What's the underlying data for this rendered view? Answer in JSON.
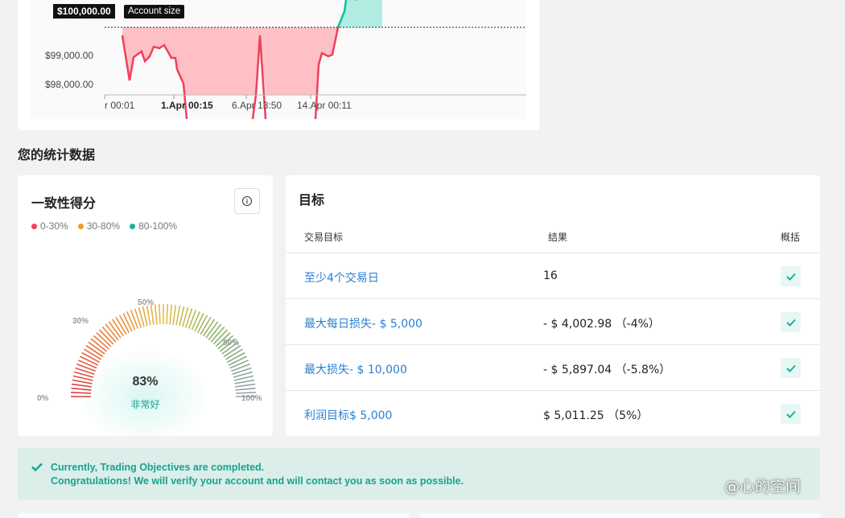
{
  "chart": {
    "account_badge": "$100,000.00",
    "account_label": "Account size",
    "y_labels": [
      "$99,000.00",
      "$98,000.00"
    ],
    "x_labels": [
      "r 00:01",
      "1.Apr 00:15",
      "6.Apr 13:50",
      "14.Apr 00:11"
    ]
  },
  "chart_data": {
    "type": "line",
    "title": "",
    "ylabel": "",
    "xlabel": "",
    "reference_line": {
      "label": "Account size",
      "value": 100000
    },
    "y_ticks": [
      99000,
      98000
    ],
    "x_ticks": [
      "r 00:01",
      "1.Apr 00:15",
      "6.Apr 13:50",
      "14.Apr 00:11"
    ],
    "colors": {
      "below": "#ffc0c5",
      "above": "#b2ece2",
      "line_below": "#f0405a",
      "line_above": "#10bfa0"
    },
    "note": "equity curve fills red below account size and green above"
  },
  "stats": {
    "section_title": "您的统计数据"
  },
  "consistency": {
    "title": "一致性得分",
    "legend": [
      {
        "label": "0-30%",
        "color": "#f04250"
      },
      {
        "label": "30-80%",
        "color": "#f09a22"
      },
      {
        "label": "80-100%",
        "color": "#12b59a"
      }
    ],
    "gauge_ticks": [
      "0%",
      "30%",
      "50%",
      "80%",
      "100%"
    ],
    "score_value": 83,
    "score": "83%",
    "score_text": "非常好",
    "info_icon": "info-icon"
  },
  "objectives": {
    "title": "目标",
    "headers": {
      "objective": "交易目标",
      "result": "结果",
      "summary": "概括"
    },
    "rows": [
      {
        "name": "至少4个交易日",
        "result": "16",
        "passed": true
      },
      {
        "name": "最大每日损失- $ 5,000",
        "result": "- $ 4,002.98 （-4%）",
        "passed": true
      },
      {
        "name": "最大损失- $ 10,000",
        "result": "- $ 5,897.04 （-5.8%）",
        "passed": true
      },
      {
        "name": "利润目标$ 5,000",
        "result": "$ 5,011.25 （5%）",
        "passed": true
      }
    ]
  },
  "alert": {
    "line1": "Currently, Trading Objectives are completed.",
    "line2": "Congratulations! We will verify your account and will contact you as soon as possible.",
    "icon": "check-icon",
    "color": "#14a48f"
  },
  "watermark": "@心的空间"
}
